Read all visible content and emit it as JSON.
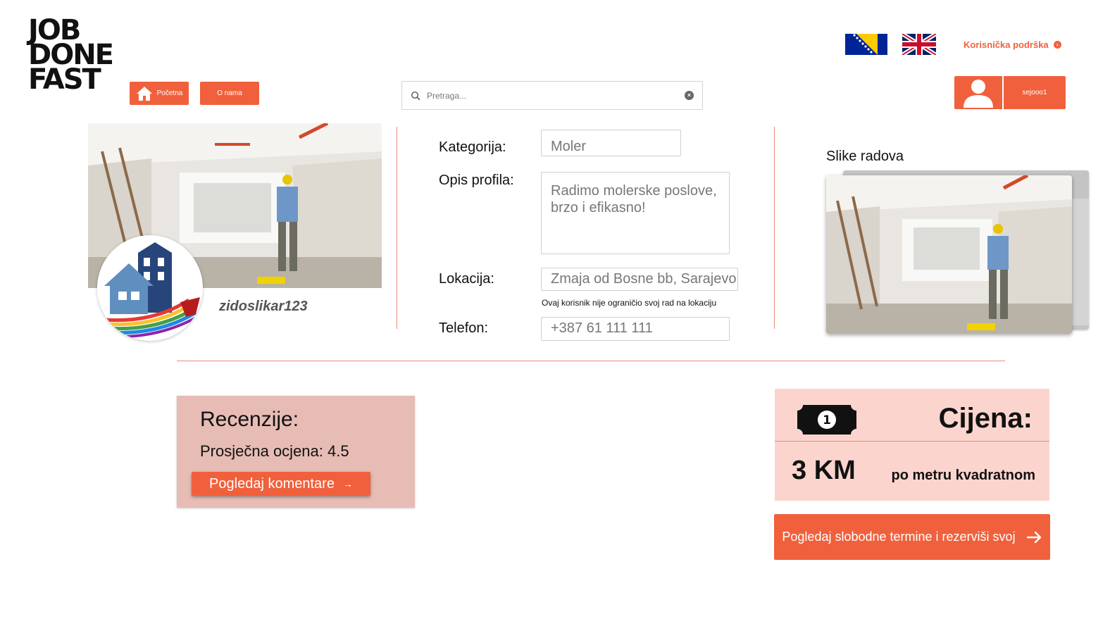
{
  "logo": {
    "line1": "JOB",
    "line2": "DONE",
    "line3": "FAST"
  },
  "nav": {
    "home_label": "Početna",
    "about_label": "O nama"
  },
  "search": {
    "placeholder": "Pretraga..."
  },
  "header": {
    "support_label": "Korisnička podrška",
    "username": "sejooo1"
  },
  "profile": {
    "username": "zidoslikar123",
    "category_label": "Kategorija:",
    "category_value": "Moler",
    "description_label": "Opis profila:",
    "description_value": "Radimo molerske poslove, brzo i efikasno!",
    "location_label": "Lokacija:",
    "location_value": "Zmaja od Bosne bb, Sarajevo",
    "location_note": "Ovaj korisnik nije ograničio svoj rad na lokaciju",
    "phone_label": "Telefon:",
    "phone_value": "+387 61 111 111"
  },
  "gallery": {
    "title": "Slike radova"
  },
  "reviews": {
    "title": "Recenzije:",
    "average": "Prosječna ocjena: 4.5",
    "button_label": "Pogledaj komentare"
  },
  "price": {
    "title": "Cijena:",
    "value": "3 KM",
    "unit": "po metru kvadratnom",
    "icon_digit": "1"
  },
  "booking": {
    "button_label": "Pogledaj slobodne termine i rezerviši svoj"
  },
  "colors": {
    "accent": "#f1603c",
    "reviews_bg": "#e6bcb5",
    "price_bg": "#fbd5cd",
    "divider": "#e98a78"
  }
}
